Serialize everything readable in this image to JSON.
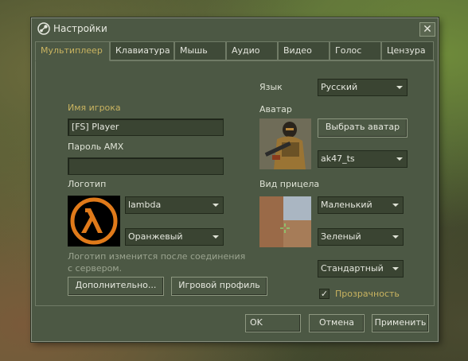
{
  "window": {
    "title": "Настройки",
    "close_symbol": "✕"
  },
  "tabs": [
    {
      "label": "Мультиплеер",
      "active": true
    },
    {
      "label": "Клавиатура"
    },
    {
      "label": "Мышь"
    },
    {
      "label": "Аудио"
    },
    {
      "label": "Видео"
    },
    {
      "label": "Голос"
    },
    {
      "label": "Цензура"
    }
  ],
  "left": {
    "player_name_label": "Имя игрока",
    "player_name_value": "[FS] Player",
    "amx_password_label": "Пароль AMX",
    "amx_password_value": "",
    "logo_label": "Логотип",
    "logo_select": "lambda",
    "logo_color_select": "Оранжевый",
    "logo_hint": "Логотип изменится после соединения с сервером.",
    "advanced_button": "Дополнительно...",
    "game_profile_button": "Игровой профиль"
  },
  "right": {
    "language_label": "Язык",
    "language_select": "Русский",
    "avatar_label": "Аватар",
    "choose_avatar_button": "Выбрать аватар",
    "avatar_select": "ak47_ts",
    "crosshair_label": "Вид прицела",
    "crosshair_size_select": "Маленький",
    "crosshair_color_select": "Зеленый",
    "crosshair_type_select": "Стандартный",
    "transparency_label": "Прозрачность",
    "transparency_checked": true
  },
  "footer": {
    "ok": "OK",
    "cancel": "Отмена",
    "apply": "Применить"
  },
  "colors": {
    "panel": "#4c5844",
    "accent_text": "#c9b360",
    "logo_orange": "#e07a1a"
  }
}
